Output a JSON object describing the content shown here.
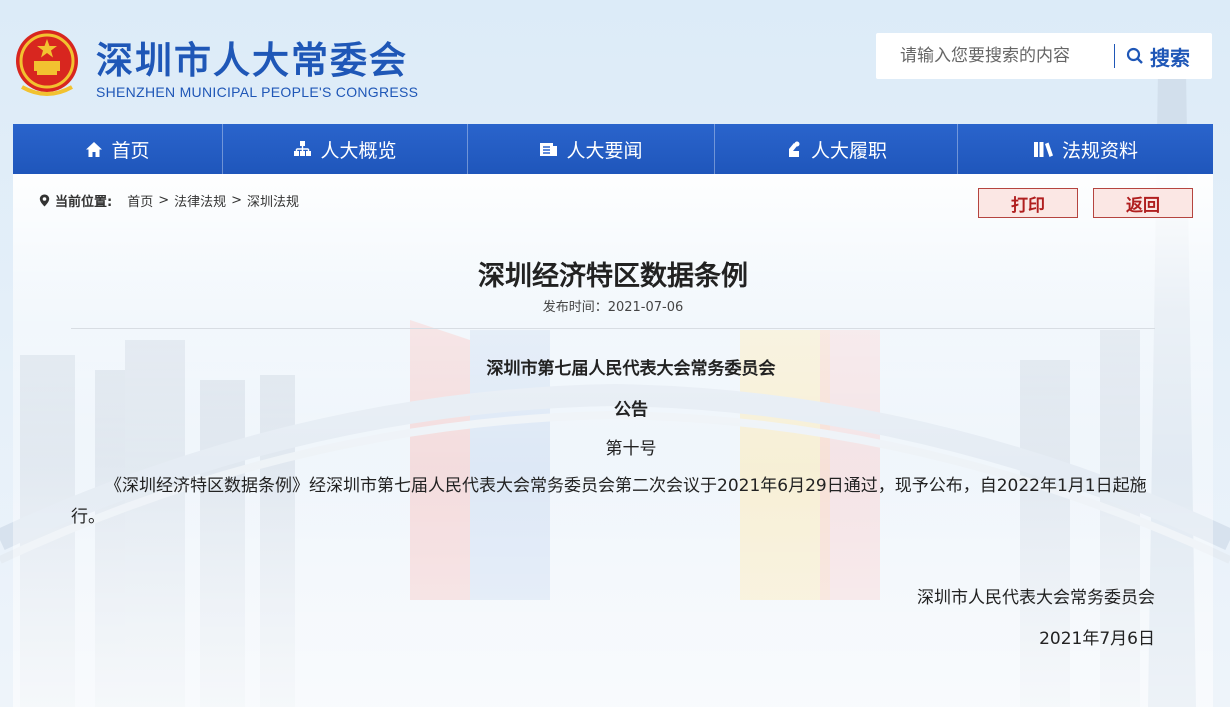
{
  "site": {
    "title": "深圳市人大常委会",
    "subtitle": "SHENZHEN MUNICIPAL PEOPLE'S CONGRESS"
  },
  "search": {
    "placeholder": "请输入您要搜索的内容",
    "button_label": "搜索"
  },
  "nav": {
    "items": [
      {
        "label": "首页",
        "icon": "home-icon"
      },
      {
        "label": "人大概览",
        "icon": "org-chart-icon"
      },
      {
        "label": "人大要闻",
        "icon": "news-icon"
      },
      {
        "label": "人大履职",
        "icon": "duty-icon"
      },
      {
        "label": "法规资料",
        "icon": "books-icon"
      }
    ]
  },
  "breadcrumb": {
    "label": "当前位置:",
    "items": [
      "首页",
      "法律法规",
      "深圳法规"
    ],
    "separator": ">"
  },
  "actions": {
    "print_label": "打印",
    "back_label": "返回"
  },
  "article": {
    "title": "深圳经济特区数据条例",
    "pubdate": "发布时间：2021-07-06",
    "issuer": "深圳市第七届人民代表大会常务委员会",
    "notice_heading": "公告",
    "notice_number": "第十号",
    "body": "《深圳经济特区数据条例》经深圳市第七届人民代表大会常务委员会第二次会议于2021年6月29日通过，现予公布，自2022年1月1日起施行。",
    "signature": "深圳市人民代表大会常务委员会",
    "sign_date": "2021年7月6日"
  },
  "colors": {
    "brand_blue": "#1f57b7",
    "nav_blue": "#2a64cc",
    "action_red": "#b01f1f"
  }
}
